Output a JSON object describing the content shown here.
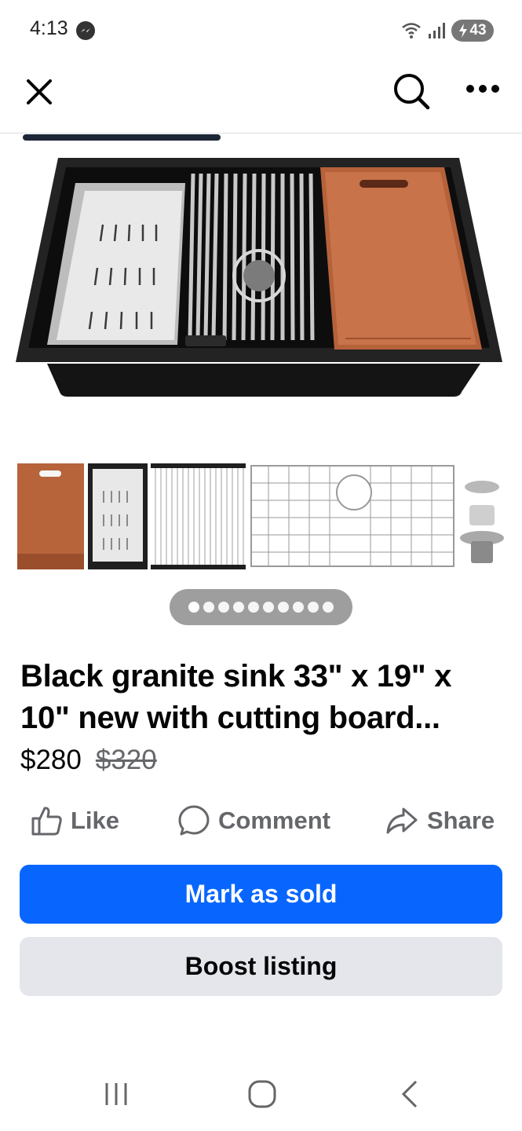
{
  "status_bar": {
    "time": "4:13",
    "battery": "43",
    "icons": [
      "messenger-icon",
      "wifi-icon",
      "signal-icon",
      "battery-charging-icon"
    ]
  },
  "top_nav": {
    "icons": [
      "close-icon",
      "search-icon",
      "more-icon"
    ]
  },
  "gallery": {
    "page_count": 10,
    "active_index": 0,
    "thumbnails": [
      "cutting-board",
      "colander",
      "roll-up-rack",
      "bottom-grid",
      "drain-strainer"
    ]
  },
  "listing": {
    "title": "Black granite sink 33\" x 19\" x 10\" new with cutting board...",
    "price": "$280",
    "original_price": "$320"
  },
  "actions": {
    "like": "Like",
    "comment": "Comment",
    "share": "Share"
  },
  "buttons": {
    "mark_sold": "Mark as sold",
    "boost": "Boost listing"
  },
  "colors": {
    "primary": "#0866ff",
    "secondary_bg": "#e4e6eb",
    "muted_text": "#65676b",
    "text": "#050505"
  },
  "android_nav": [
    "recents-icon",
    "home-icon",
    "back-icon"
  ]
}
